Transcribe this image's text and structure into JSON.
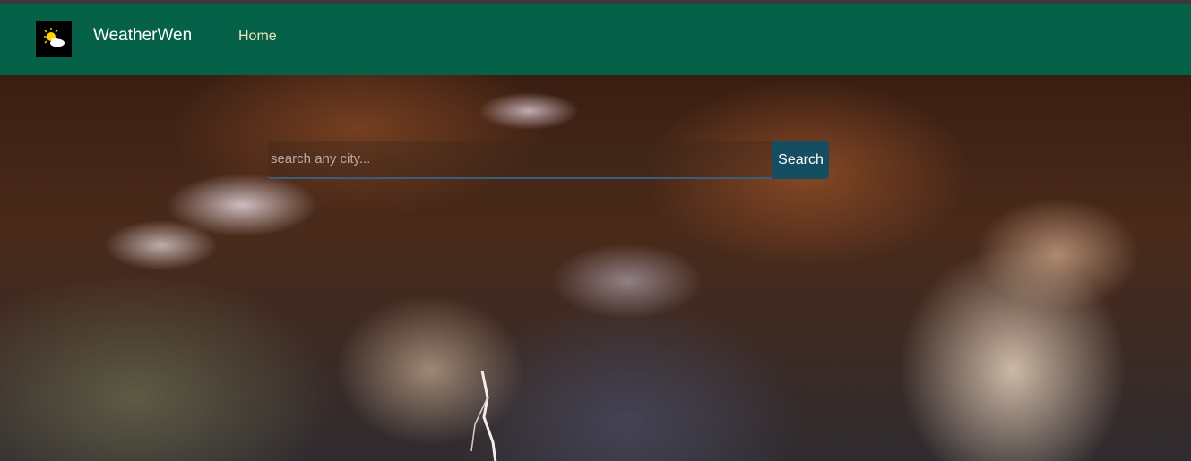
{
  "navbar": {
    "brand": "WeatherWen",
    "logo_icon": "sun-cloud-icon",
    "links": [
      {
        "label": "Home"
      }
    ]
  },
  "search": {
    "placeholder": "search any city...",
    "value": "",
    "button_label": "Search"
  },
  "colors": {
    "navbar_bg": "#056249",
    "brand_text": "#ffffff",
    "nav_link": "#f3e3b8",
    "search_button_bg": "#154e63"
  }
}
